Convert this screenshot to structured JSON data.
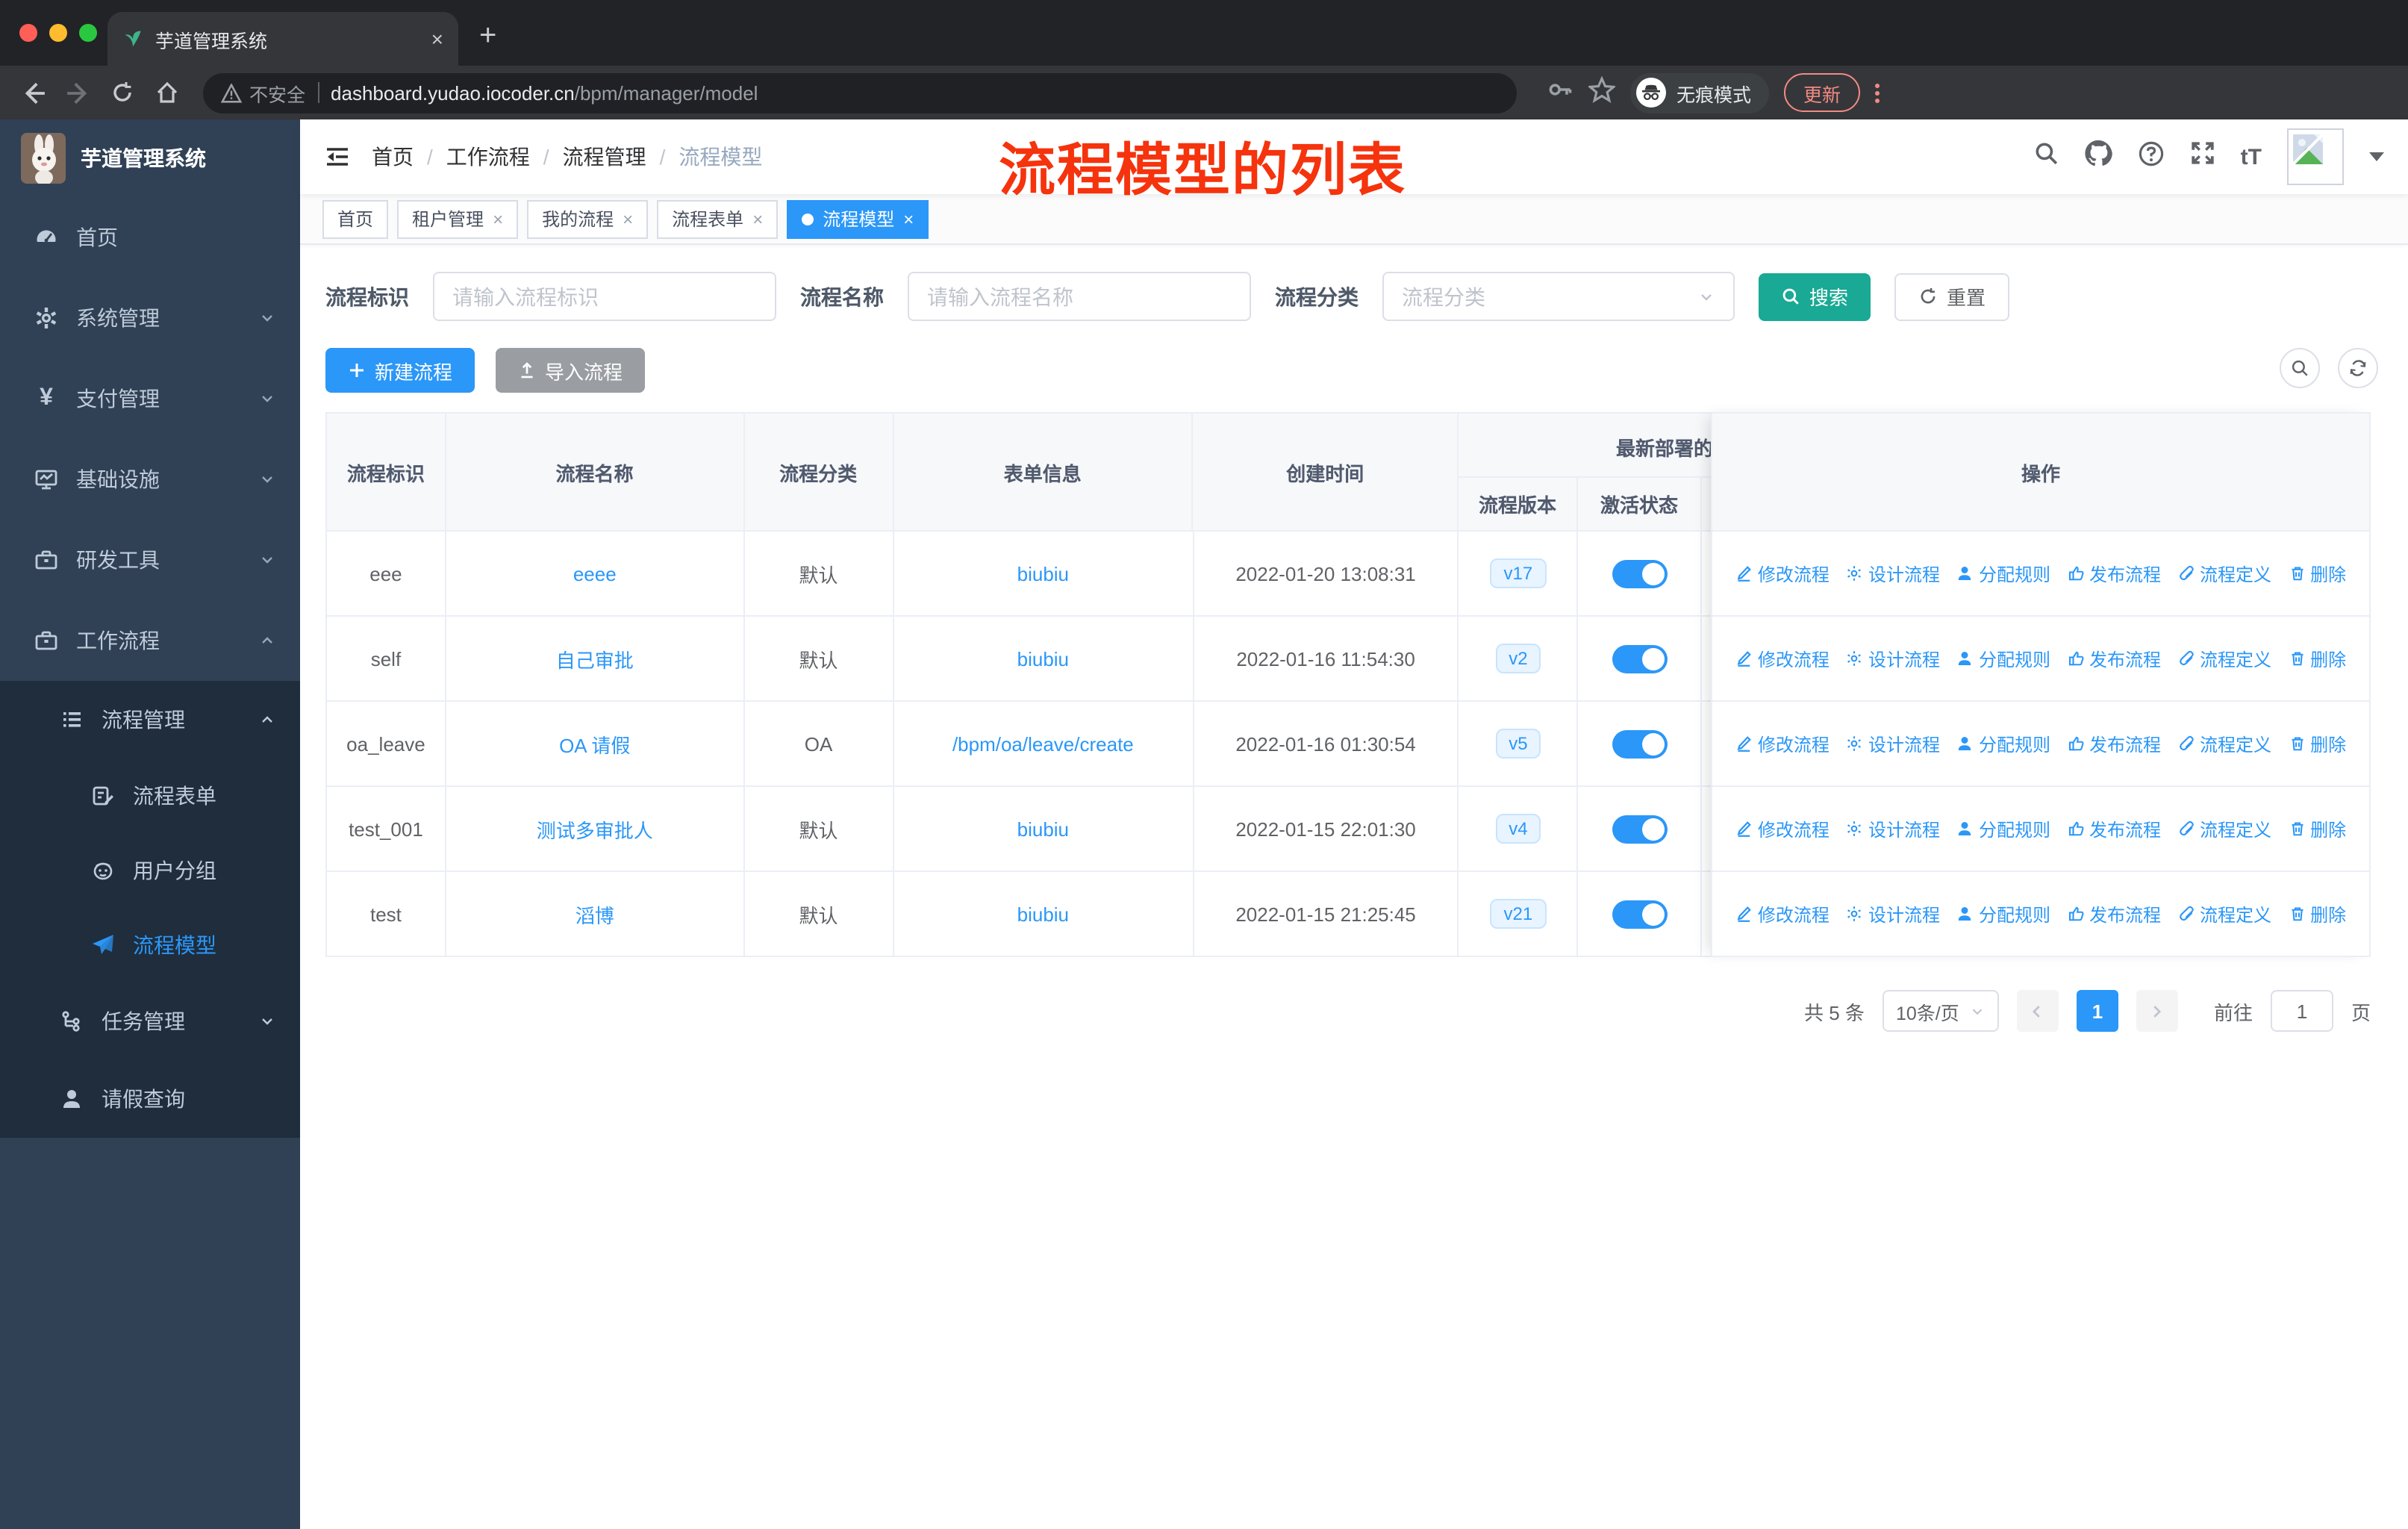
{
  "browser": {
    "tab_title": "芋道管理系统",
    "new_tab": "+",
    "close_tab": "×",
    "security_label": "不安全",
    "url_host": "dashboard.yudao.iocoder.cn",
    "url_path": "/bpm/manager/model",
    "incognito_label": "无痕模式",
    "update_label": "更新"
  },
  "sidebar": {
    "app_title": "芋道管理系统",
    "items": [
      {
        "label": "首页"
      },
      {
        "label": "系统管理"
      },
      {
        "label": "支付管理"
      },
      {
        "label": "基础设施"
      },
      {
        "label": "研发工具"
      },
      {
        "label": "工作流程"
      }
    ],
    "sub_items": [
      {
        "label": "流程管理"
      },
      {
        "label": "流程表单"
      },
      {
        "label": "用户分组"
      },
      {
        "label": "流程模型"
      },
      {
        "label": "任务管理"
      },
      {
        "label": "请假查询"
      }
    ]
  },
  "header": {
    "breadcrumb": [
      "首页",
      "工作流程",
      "流程管理",
      "流程模型"
    ],
    "annotation": "流程模型的列表"
  },
  "tags": {
    "t0": "首页",
    "t1": "租户管理",
    "t2": "我的流程",
    "t3": "流程表单",
    "t4": "流程模型"
  },
  "filters": {
    "id_label": "流程标识",
    "id_placeholder": "请输入流程标识",
    "name_label": "流程名称",
    "name_placeholder": "请输入流程名称",
    "category_label": "流程分类",
    "category_placeholder": "流程分类",
    "search_label": "搜索",
    "reset_label": "重置"
  },
  "toolbar": {
    "create_label": "新建流程",
    "import_label": "导入流程"
  },
  "table": {
    "col_headers": [
      "流程标识",
      "流程名称",
      "流程分类",
      "表单信息",
      "创建时间"
    ],
    "group_header": "最新部署的",
    "sub_headers": [
      "流程版本",
      "激活状态"
    ],
    "ops_header": "操作",
    "op_labels": [
      "修改流程",
      "设计流程",
      "分配规则",
      "发布流程",
      "流程定义",
      "删除"
    ],
    "rows": [
      {
        "id": "eee",
        "name": "eeee",
        "category": "默认",
        "form": "biubiu",
        "created": "2022-01-20 13:08:31",
        "version": "v17"
      },
      {
        "id": "self",
        "name": "自己审批",
        "category": "默认",
        "form": "biubiu",
        "created": "2022-01-16 11:54:30",
        "version": "v2"
      },
      {
        "id": "oa_leave",
        "name": "OA 请假",
        "category": "OA",
        "form": "/bpm/oa/leave/create",
        "created": "2022-01-16 01:30:54",
        "version": "v5"
      },
      {
        "id": "test_001",
        "name": "测试多审批人",
        "category": "默认",
        "form": "biubiu",
        "created": "2022-01-15 22:01:30",
        "version": "v4"
      },
      {
        "id": "test",
        "name": "滔博",
        "category": "默认",
        "form": "biubiu",
        "created": "2022-01-15 21:25:45",
        "version": "v21"
      }
    ]
  },
  "pagination": {
    "total_label": "共 5 条",
    "page_size": "10条/页",
    "current_page": "1",
    "goto_label": "前往",
    "goto_value": "1",
    "page_suffix": "页"
  },
  "colors": {
    "accent_blue": "#2b97f8",
    "search_teal": "#19a994",
    "gray_button": "#9a9da2",
    "sidebar_bg": "#304156",
    "submenu_bg": "#1f2d3d",
    "annotation_red": "#f5330d",
    "badge_bg": "#e8f4ff"
  }
}
